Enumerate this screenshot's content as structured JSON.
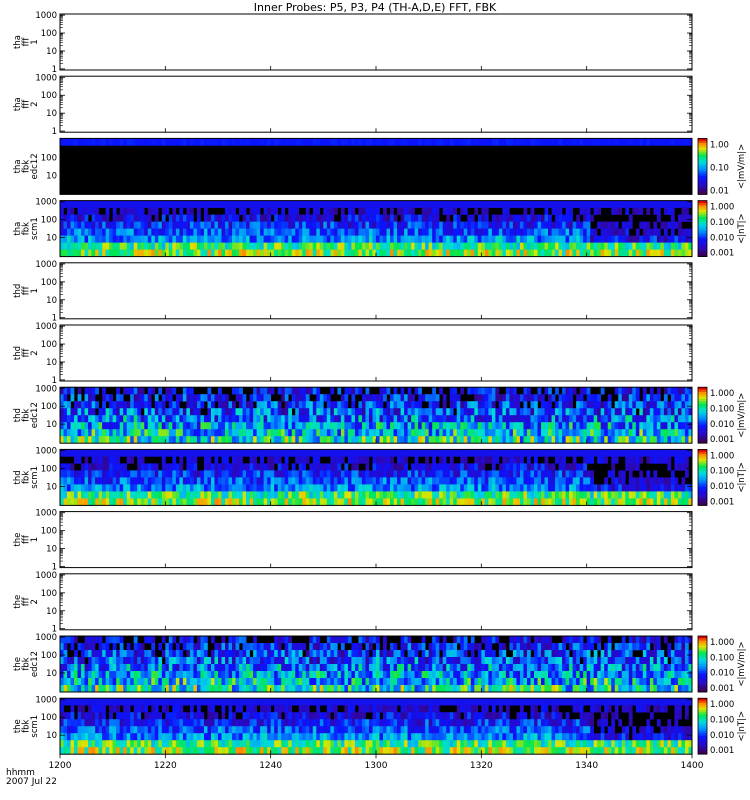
{
  "title": "Inner Probes: P5, P3, P4 (TH-A,D,E) FFT, FBK",
  "footer": {
    "label_line1": "hhmm",
    "label_line2": "2007 Jul 22"
  },
  "x_axis": {
    "ticks": [
      "1200",
      "1220",
      "1240",
      "1300",
      "1320",
      "1340",
      "1400"
    ]
  },
  "colors": {
    "background": "#ffffff",
    "axis": "#000000",
    "spectrogram_bg": "#000000"
  },
  "chart_data": [
    {
      "type": "heatmap",
      "label": [
        "tha",
        "fff",
        "1"
      ],
      "data": "empty",
      "yscale": "log",
      "yticks": [
        "1000",
        "100",
        "10",
        "1"
      ],
      "ylim": [
        1,
        1000
      ]
    },
    {
      "type": "heatmap",
      "label": [
        "tha",
        "fff",
        "2"
      ],
      "data": "empty",
      "yscale": "log",
      "yticks": [
        "1000",
        "100",
        "10",
        "1"
      ],
      "ylim": [
        1,
        1000
      ]
    },
    {
      "type": "heatmap",
      "label": [
        "tha",
        "fbk",
        "edc12"
      ],
      "data": "spectrogram",
      "pattern": "mostly-empty-top-band",
      "yscale": "log",
      "yticks": [
        "100",
        "10"
      ],
      "colorbar": {
        "ticks": [
          "1.00",
          "0.10",
          "0.01"
        ],
        "unit": "<|mV/m|>"
      }
    },
    {
      "type": "heatmap",
      "label": [
        "tha",
        "fbk",
        "scm1"
      ],
      "data": "spectrogram",
      "pattern": "scm",
      "yscale": "log",
      "yticks": [
        "1000",
        "100",
        "10"
      ],
      "colorbar": {
        "ticks": [
          "1.000",
          "0.100",
          "0.010",
          "0.001"
        ],
        "unit": "<|nT|>"
      }
    },
    {
      "type": "heatmap",
      "label": [
        "thd",
        "fff",
        "1"
      ],
      "data": "empty",
      "yscale": "log",
      "yticks": [
        "1000",
        "100",
        "10",
        "1"
      ],
      "ylim": [
        1,
        1000
      ]
    },
    {
      "type": "heatmap",
      "label": [
        "thd",
        "fff",
        "2"
      ],
      "data": "empty",
      "yscale": "log",
      "yticks": [
        "1000",
        "100",
        "10",
        "1"
      ],
      "ylim": [
        1,
        1000
      ]
    },
    {
      "type": "heatmap",
      "label": [
        "thd",
        "fbk",
        "edc12"
      ],
      "data": "spectrogram",
      "pattern": "edc",
      "yscale": "log",
      "yticks": [
        "1000",
        "100",
        "10"
      ],
      "colorbar": {
        "ticks": [
          "1.000",
          "0.100",
          "0.010",
          "0.001"
        ],
        "unit": "<|mV/m|>"
      }
    },
    {
      "type": "heatmap",
      "label": [
        "thd",
        "fbk",
        "scm1"
      ],
      "data": "spectrogram",
      "pattern": "scm",
      "yscale": "log",
      "yticks": [
        "1000",
        "100",
        "10"
      ],
      "colorbar": {
        "ticks": [
          "1.000",
          "0.100",
          "0.010",
          "0.001"
        ],
        "unit": "<|nT|>"
      }
    },
    {
      "type": "heatmap",
      "label": [
        "the",
        "fff",
        "1"
      ],
      "data": "empty",
      "yscale": "log",
      "yticks": [
        "1000",
        "100",
        "10",
        "1"
      ],
      "ylim": [
        1,
        1000
      ]
    },
    {
      "type": "heatmap",
      "label": [
        "the",
        "fff",
        "2"
      ],
      "data": "empty",
      "yscale": "log",
      "yticks": [
        "1000",
        "100",
        "10",
        "1"
      ],
      "ylim": [
        1,
        1000
      ]
    },
    {
      "type": "heatmap",
      "label": [
        "the",
        "fbk",
        "edc12"
      ],
      "data": "spectrogram",
      "pattern": "edc",
      "yscale": "log",
      "yticks": [
        "1000",
        "100",
        "10"
      ],
      "colorbar": {
        "ticks": [
          "1.000",
          "0.100",
          "0.010",
          "0.001"
        ],
        "unit": "<|mV/m|>"
      }
    },
    {
      "type": "heatmap",
      "label": [
        "the",
        "fbk",
        "scm1"
      ],
      "data": "spectrogram",
      "pattern": "scm",
      "yscale": "log",
      "yticks": [
        "1000",
        "100",
        "10"
      ],
      "colorbar": {
        "ticks": [
          "1.000",
          "0.100",
          "0.010",
          "0.001"
        ],
        "unit": "<|nT|>"
      }
    }
  ]
}
